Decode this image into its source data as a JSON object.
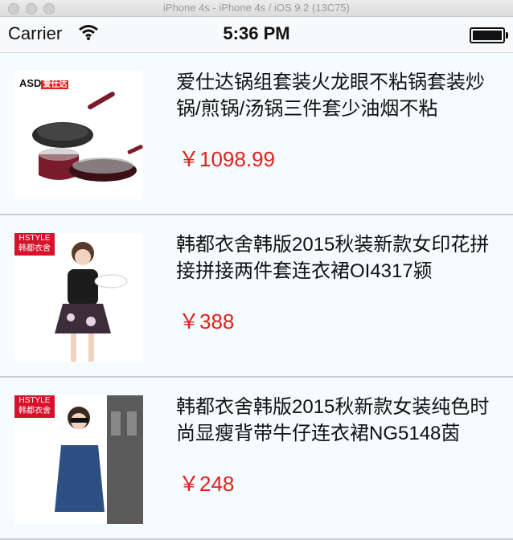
{
  "window": {
    "title": "iPhone 4s - iPhone 4s / iOS 9.2 (13C75)"
  },
  "statusbar": {
    "carrier": "Carrier",
    "time": "5:36 PM"
  },
  "products": [
    {
      "title": "爱仕达锅组套装火龙眼不粘锅套装炒锅/煎锅/汤锅三件套少油烟不粘",
      "price": "￥1098.99",
      "brand": "ASD",
      "brand_sub": "爱仕达"
    },
    {
      "title": "韩都衣舍韩版2015秋装新款女印花拼接拼接两件套连衣裙OI4317颍",
      "price": "￥388",
      "brand": "HSTYLE",
      "brand_sub": "韩都衣舍"
    },
    {
      "title": "韩都衣舍韩版2015秋新款女装纯色时尚显瘦背带牛仔连衣裙NG5148茵",
      "price": "￥248",
      "brand": "HSTYLE",
      "brand_sub": "韩都衣舍"
    }
  ]
}
